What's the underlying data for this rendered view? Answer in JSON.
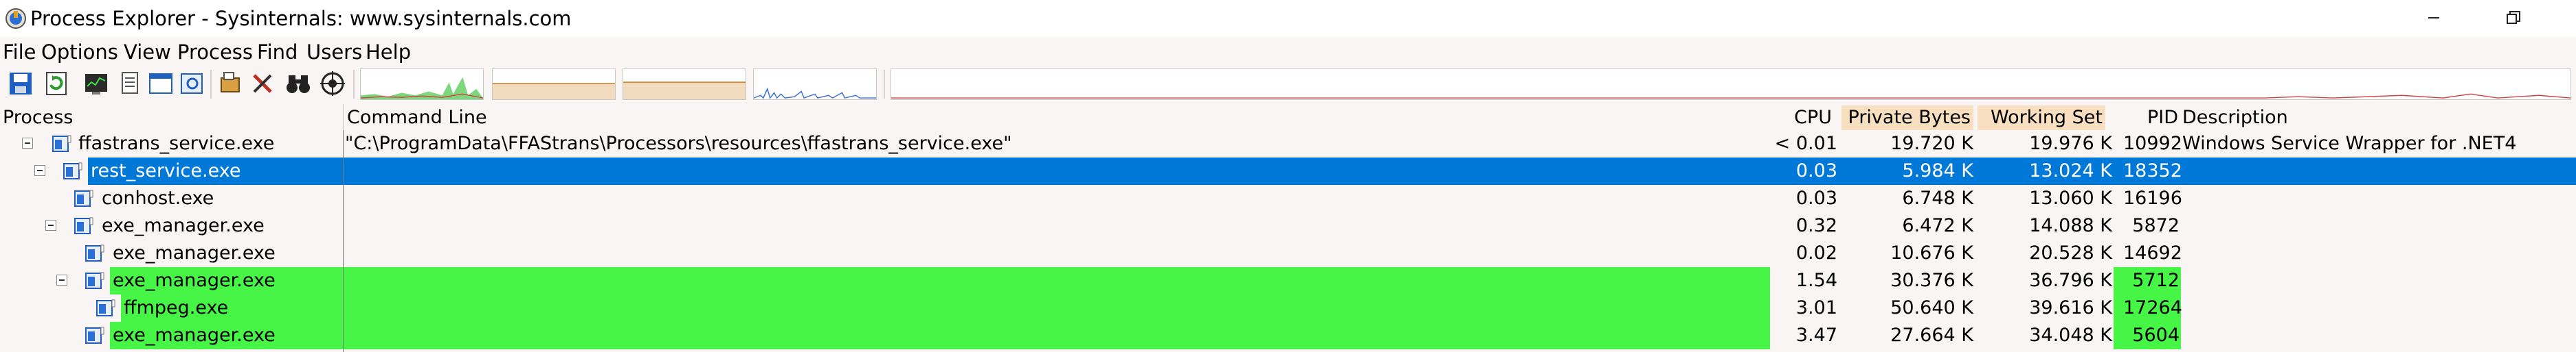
{
  "window": {
    "title": "Process Explorer - Sysinternals: www.sysinternals.com",
    "minimize_icon": "minimize-icon",
    "maximize_icon": "maximize-icon"
  },
  "menu": [
    "File",
    "Options",
    "View",
    "Process",
    "Find",
    "Users",
    "Help"
  ],
  "toolbar": {
    "buttons": [
      "save-icon",
      "refresh-icon",
      "system-info-icon",
      "properties-icon",
      "window-icon",
      "find-window-icon",
      "kill-process-icon",
      "binoculars-icon",
      "crosshair-target-icon"
    ],
    "graphs": [
      "cpu-graph",
      "commit-graph",
      "io-graph",
      "gpu-graph"
    ]
  },
  "columns": {
    "process": "Process",
    "command_line": "Command Line",
    "cpu": "CPU",
    "private_bytes": "Private Bytes",
    "working_set": "Working Set",
    "pid": "PID",
    "description": "Description"
  },
  "colors": {
    "selected": "#0078d7",
    "new_process": "#47f547",
    "sort_header": "#f7dfbf"
  },
  "rows": [
    {
      "name": "ffastrans_service.exe",
      "cmd": "\"C:\\ProgramData\\FFAStrans\\Processors\\resources\\ffastrans_service.exe\"",
      "cpu": "< 0.01",
      "private": "19.720 K",
      "working": "19.976 K",
      "pid": "10992",
      "desc": "Windows Service Wrapper for .NET4",
      "state": "normal"
    },
    {
      "name": "rest_service.exe",
      "cmd": "",
      "cpu": "0.03",
      "private": "5.984 K",
      "working": "13.024 K",
      "pid": "18352",
      "desc": "",
      "state": "selected"
    },
    {
      "name": "conhost.exe",
      "cmd": "",
      "cpu": "0.03",
      "private": "6.748 K",
      "working": "13.060 K",
      "pid": "16196",
      "desc": "",
      "state": "normal"
    },
    {
      "name": "exe_manager.exe",
      "cmd": "",
      "cpu": "0.32",
      "private": "6.472 K",
      "working": "14.088 K",
      "pid": "5872",
      "desc": "",
      "state": "normal"
    },
    {
      "name": "exe_manager.exe",
      "cmd": "",
      "cpu": "0.02",
      "private": "10.676 K",
      "working": "20.528 K",
      "pid": "14692",
      "desc": "",
      "state": "normal"
    },
    {
      "name": "exe_manager.exe",
      "cmd": "",
      "cpu": "1.54",
      "private": "30.376 K",
      "working": "36.796 K",
      "pid": "5712",
      "desc": "",
      "state": "new"
    },
    {
      "name": "ffmpeg.exe",
      "cmd": "",
      "cpu": "3.01",
      "private": "50.640 K",
      "working": "39.616 K",
      "pid": "17264",
      "desc": "",
      "state": "new"
    },
    {
      "name": "exe_manager.exe",
      "cmd": "",
      "cpu": "3.47",
      "private": "27.664 K",
      "working": "34.048 K",
      "pid": "5604",
      "desc": "",
      "state": "new"
    }
  ]
}
